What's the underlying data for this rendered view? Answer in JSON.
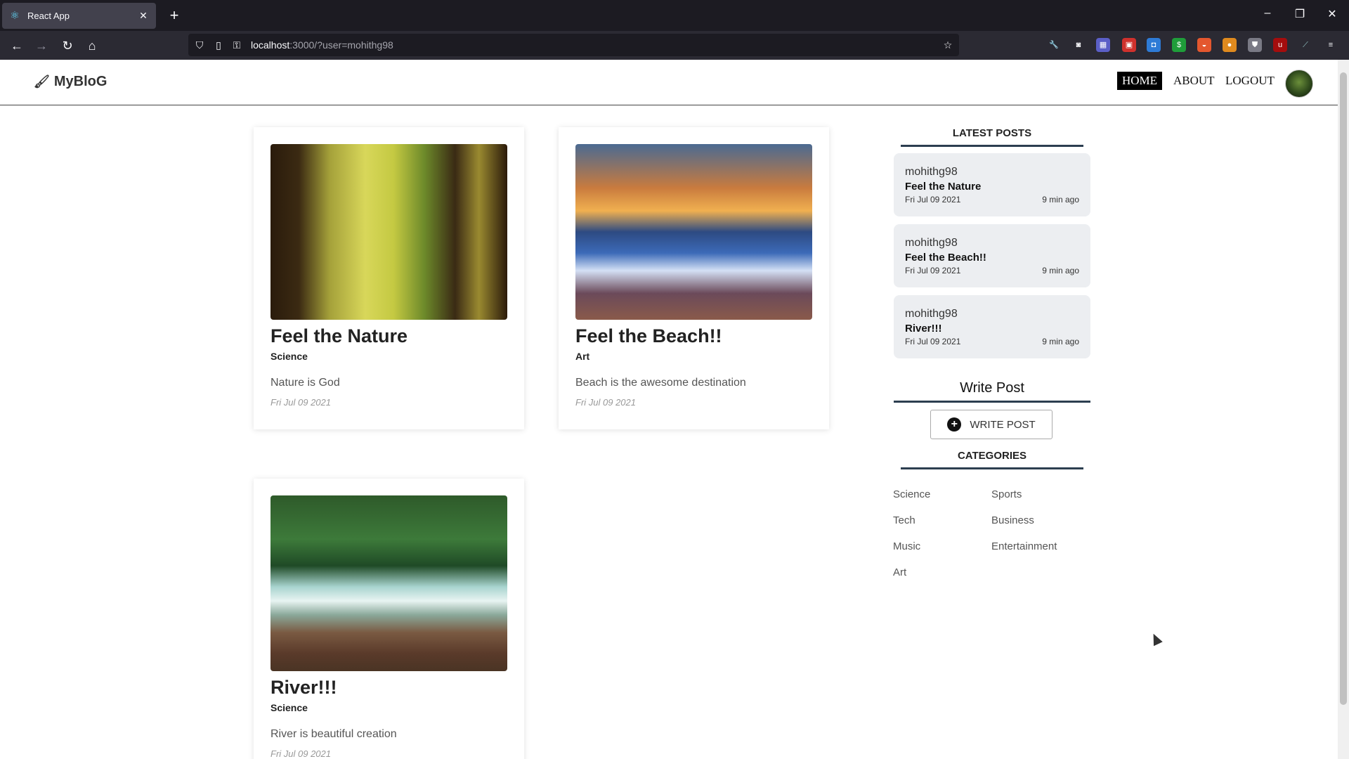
{
  "browser": {
    "tab_title": "React App",
    "url_host": "localhost",
    "url_rest": ":3000/?user=mohithg98",
    "icons": {
      "tab_favicon": "react-icon",
      "new_tab": "plus-icon",
      "back": "arrow-left-icon",
      "forward": "arrow-right-icon",
      "reload": "reload-icon",
      "home": "home-icon",
      "bookmark": "star-icon"
    }
  },
  "site": {
    "brand": "MyBloG",
    "nav": {
      "home": "HOME",
      "about": "ABOUT",
      "logout": "LOGOUT"
    }
  },
  "posts": [
    {
      "title": "Feel the Nature",
      "category": "Science",
      "description": "Nature is God",
      "date": "Fri Jul 09 2021"
    },
    {
      "title": "Feel the Beach!!",
      "category": "Art",
      "description": "Beach is the awesome destination",
      "date": "Fri Jul 09 2021"
    },
    {
      "title": "River!!!",
      "category": "Science",
      "description": "River is beautiful creation",
      "date": "Fri Jul 09 2021"
    }
  ],
  "sidebar": {
    "latest_heading": "LATEST POSTS",
    "latest": [
      {
        "user": "mohithg98",
        "title": "Feel the Nature",
        "date": "Fri Jul 09 2021",
        "ago": "9 min ago"
      },
      {
        "user": "mohithg98",
        "title": "Feel the Beach!!",
        "date": "Fri Jul 09 2021",
        "ago": "9 min ago"
      },
      {
        "user": "mohithg98",
        "title": "River!!!",
        "date": "Fri Jul 09 2021",
        "ago": "9 min ago"
      }
    ],
    "write_heading": "Write Post",
    "write_button": "WRITE POST",
    "categories_heading": "CATEGORIES",
    "categories": [
      "Science",
      "Sports",
      "Tech",
      "Business",
      "Music",
      "Entertainment",
      "Art"
    ]
  }
}
